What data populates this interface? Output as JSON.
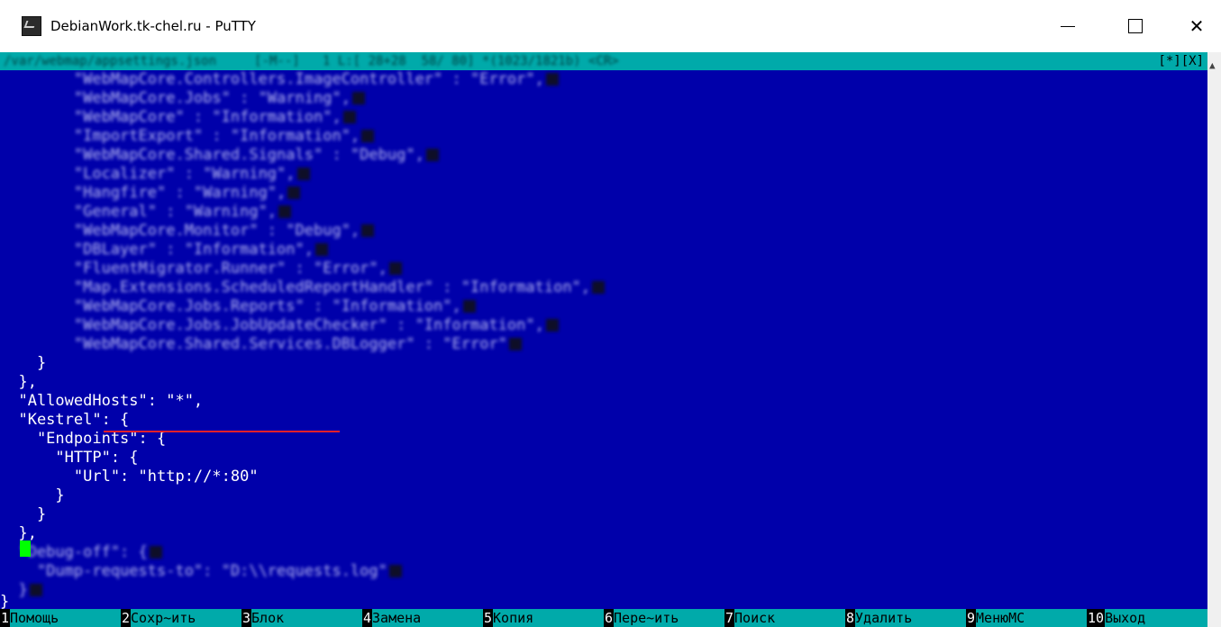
{
  "window": {
    "title": "DebianWork.tk-chel.ru - PuTTY",
    "controls": {
      "minimize": "—",
      "maximize": "☐",
      "close": "✕"
    }
  },
  "editor": {
    "status_left": "/var/webmap/appsettings.json     [-M--]   1 L:[ 28+28  58/ 80] *(1023/1821b) <CR>",
    "status_right": "[*][X]",
    "lines": [
      "        \"WebMapCore.Controllers.ImageController\" : \"Error\",",
      "        \"WebMapCore.Jobs\" : \"Warning\",",
      "        \"WebMapCore\" : \"Information\",",
      "        \"ImportExport\" : \"Information\",",
      "        \"WebMapCore.Shared.Signals\" : \"Debug\",",
      "        \"Localizer\" : \"Warning\",",
      "        \"Hangfire\" : \"Warning\",",
      "        \"General\" : \"Warning\",",
      "        \"WebMapCore.Monitor\" : \"Debug\",",
      "        \"DBLayer\" : \"Information\",",
      "        \"FluentMigrator.Runner\" : \"Error\",",
      "        \"Map.Extensions.ScheduledReportHandler\" : \"Information\",",
      "        \"WebMapCore.Jobs.Reports\" : \"Information\",",
      "        \"WebMapCore.Jobs.JobUpdateChecker\" : \"Information\",",
      "        \"WebMapCore.Shared.Services.DBLogger\" : \"Error\"",
      "    }",
      "  },",
      "  \"AllowedHosts\": \"*\",",
      "  \"Kestrel\": {",
      "    \"Endpoints\": {",
      "      \"HTTP\": {",
      "        \"Url\": \"http://*:80\"",
      "      }",
      "    }",
      "  },",
      "  \"Debug-off\": {",
      "    \"Dump-requests-to\": \"D:\\\\requests.log\"",
      "  }",
      "}"
    ]
  },
  "function_keys": [
    {
      "num": "1",
      "label": "Помощь"
    },
    {
      "num": "2",
      "label": "Сохр~ить"
    },
    {
      "num": "3",
      "label": "Блок"
    },
    {
      "num": "4",
      "label": "Замена"
    },
    {
      "num": "5",
      "label": "Копия"
    },
    {
      "num": "6",
      "label": "Пере~ить"
    },
    {
      "num": "7",
      "label": "Поиск"
    },
    {
      "num": "8",
      "label": "Удалить"
    },
    {
      "num": "9",
      "label": "МенюМС"
    },
    {
      "num": "10",
      "label": "Выход"
    }
  ],
  "colors": {
    "terminal_bg": "#0000aa",
    "status_bg": "#00aaaa",
    "highlight_underline": "#e8202a",
    "cursor": "#00ff00"
  }
}
